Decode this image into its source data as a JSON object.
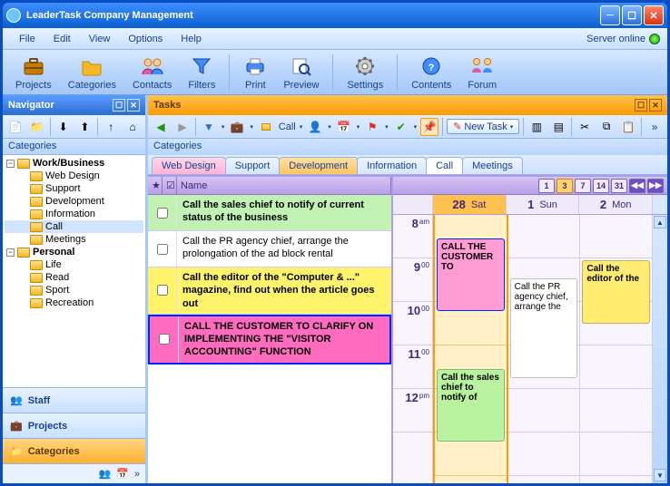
{
  "title": "LeaderTask Company Management",
  "menu": [
    "File",
    "Edit",
    "View",
    "Options",
    "Help"
  ],
  "server_status": "Server online",
  "toolbar": [
    {
      "label": "Projects",
      "color": "#c97a00",
      "icon": "briefcase"
    },
    {
      "label": "Categories",
      "color": "#f7b726",
      "icon": "folder"
    },
    {
      "label": "Contacts",
      "color": "#2a6ed0",
      "icon": "people"
    },
    {
      "label": "Filters",
      "color": "#2a6ed0",
      "icon": "funnel"
    },
    {
      "sep": true
    },
    {
      "label": "Print",
      "color": "#2a6ed0",
      "icon": "printer"
    },
    {
      "label": "Preview",
      "color": "#2a6ed0",
      "icon": "magnify"
    },
    {
      "sep": true
    },
    {
      "label": "Settings",
      "color": "#888",
      "icon": "gear"
    },
    {
      "sep": true
    },
    {
      "label": "Contents",
      "color": "#2a6ed0",
      "icon": "help"
    },
    {
      "label": "Forum",
      "color": "#2a6ed0",
      "icon": "forum"
    }
  ],
  "nav": {
    "title": "Navigator",
    "section": "Categories",
    "tree": {
      "root1": {
        "label": "Work/Business",
        "bold": true,
        "expanded": true,
        "children": [
          "Web Design",
          "Support",
          "Development",
          "Information",
          "Call",
          "Meetings"
        ],
        "selected": "Call"
      },
      "root2": {
        "label": "Personal",
        "bold": true,
        "expanded": true,
        "children": [
          "Life",
          "Read",
          "Sport",
          "Recreation"
        ]
      }
    },
    "outlook": [
      {
        "label": "Staff",
        "active": false
      },
      {
        "label": "Projects",
        "active": false
      },
      {
        "label": "Categories",
        "active": true
      }
    ]
  },
  "tasks": {
    "title": "Tasks",
    "newtask": "New Task",
    "section": "Categories",
    "tabs": [
      {
        "label": "Web Design",
        "cls": "pink"
      },
      {
        "label": "Support",
        "cls": "plain"
      },
      {
        "label": "Development",
        "cls": "orange"
      },
      {
        "label": "Information",
        "cls": "plain"
      },
      {
        "label": "Call",
        "cls": "active"
      },
      {
        "label": "Meetings",
        "cls": "plain"
      }
    ],
    "name_col": "Name",
    "rows": [
      {
        "cls": "green",
        "text": "Call the sales chief to notify of current status of the business"
      },
      {
        "cls": "white",
        "text": "Call the PR agency chief, arrange the prolongation of the ad block rental"
      },
      {
        "cls": "yellow",
        "text": "Call the editor of the \"Computer & ...\" magazine, find out when the article goes out"
      },
      {
        "cls": "pink",
        "text": "CALL THE CUSTOMER TO CLARIFY ON IMPLEMENTING THE \"VISITOR ACCOUNTING\" FUNCTION"
      }
    ],
    "viewbtns": [
      "1",
      "3",
      "7",
      "14",
      "31"
    ],
    "viewsel": "3",
    "days": [
      {
        "num": "28",
        "name": "Sat",
        "today": true
      },
      {
        "num": "1",
        "name": "Sun"
      },
      {
        "num": "2",
        "name": "Mon"
      }
    ],
    "hours": [
      {
        "h": "8",
        "ap": "am"
      },
      {
        "h": "9",
        "ap": "00"
      },
      {
        "h": "10",
        "ap": "00"
      },
      {
        "h": "11",
        "ap": "00"
      },
      {
        "h": "12",
        "ap": "pm"
      }
    ],
    "appts": {
      "sat": [
        {
          "cls": "pink2",
          "text": "CALL THE CUSTOMER TO"
        },
        {
          "cls": "grn",
          "text": "Call the sales chief to notify of"
        }
      ],
      "sun": [
        {
          "cls": "wht",
          "text": "Call the PR agency chief, arrange the"
        }
      ],
      "mon": [
        {
          "cls": "yel",
          "text": "Call the editor of the"
        }
      ]
    }
  }
}
